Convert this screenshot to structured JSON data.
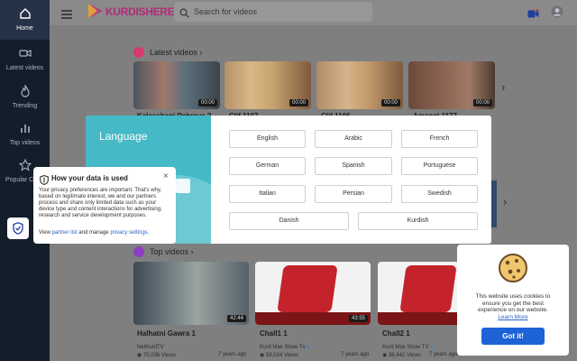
{
  "app": {
    "logo_text": "KURDISHERE"
  },
  "search": {
    "placeholder": "Search for videos"
  },
  "sidebar": {
    "items": [
      {
        "label": "Home",
        "icon": "home-icon",
        "active": true
      },
      {
        "label": "Latest videos",
        "icon": "video-camera-icon"
      },
      {
        "label": "Trending",
        "icon": "flame-icon"
      },
      {
        "label": "Top videos",
        "icon": "bar-chart-icon"
      },
      {
        "label": "Popular Ch",
        "icon": "star-icon"
      }
    ]
  },
  "latest": {
    "title": "Latest videos",
    "videos": [
      {
        "title": "Kalaashani Pahraya 2",
        "duration": "00:00"
      },
      {
        "title": "Clif 1107",
        "duration": "00:00"
      },
      {
        "title": "Clif 1106",
        "duration": "00:00"
      },
      {
        "title": "Amanet 1177",
        "duration": "00:00"
      }
    ]
  },
  "top": {
    "title": "Top videos",
    "videos": [
      {
        "title": "Halhatni Gawra 1",
        "channel": "NetKurdTV",
        "views": "70,036 Views",
        "ago": "7 years ago",
        "duration": "42:44"
      },
      {
        "title": "Chall1 1",
        "channel": "Kurd Max Show Tv",
        "views": "58,024 Views",
        "ago": "7 years ago",
        "duration": "43:55"
      },
      {
        "title": "Chall2 1",
        "channel": "Kurd Max Show TV",
        "views": "38,442 Views",
        "ago": "7 years ago",
        "duration": ""
      }
    ]
  },
  "language_modal": {
    "title": "Language",
    "languages": [
      "English",
      "Arabic",
      "French",
      "German",
      "Spanish",
      "Portuguese",
      "Italian",
      "Persian",
      "Swedish",
      "Danish",
      "Kurdish"
    ]
  },
  "privacy": {
    "title": "How your data is used",
    "close": "×",
    "body": "Your privacy preferences are important. That's why, based on legitimate interest, we and our partners process and share only limited data such as your device type and content interactions for advertising, research and service development purposes.",
    "view_prefix": "View",
    "partner_link": "partner list",
    "manage_text": "and manage",
    "settings_link": "privacy settings."
  },
  "cookie": {
    "text": "This website uses cookies to ensure you get the best experience on our website.",
    "learn_more": "Learn More",
    "button": "Got it!"
  },
  "colors": {
    "sidebar_bg": "#141e2a",
    "modal_accent": "#45b9c6",
    "latest_badge": "#d63a6f",
    "top_badge": "#8e3cc2",
    "cookie_button": "#1d63d6",
    "link": "#2a62c9"
  }
}
